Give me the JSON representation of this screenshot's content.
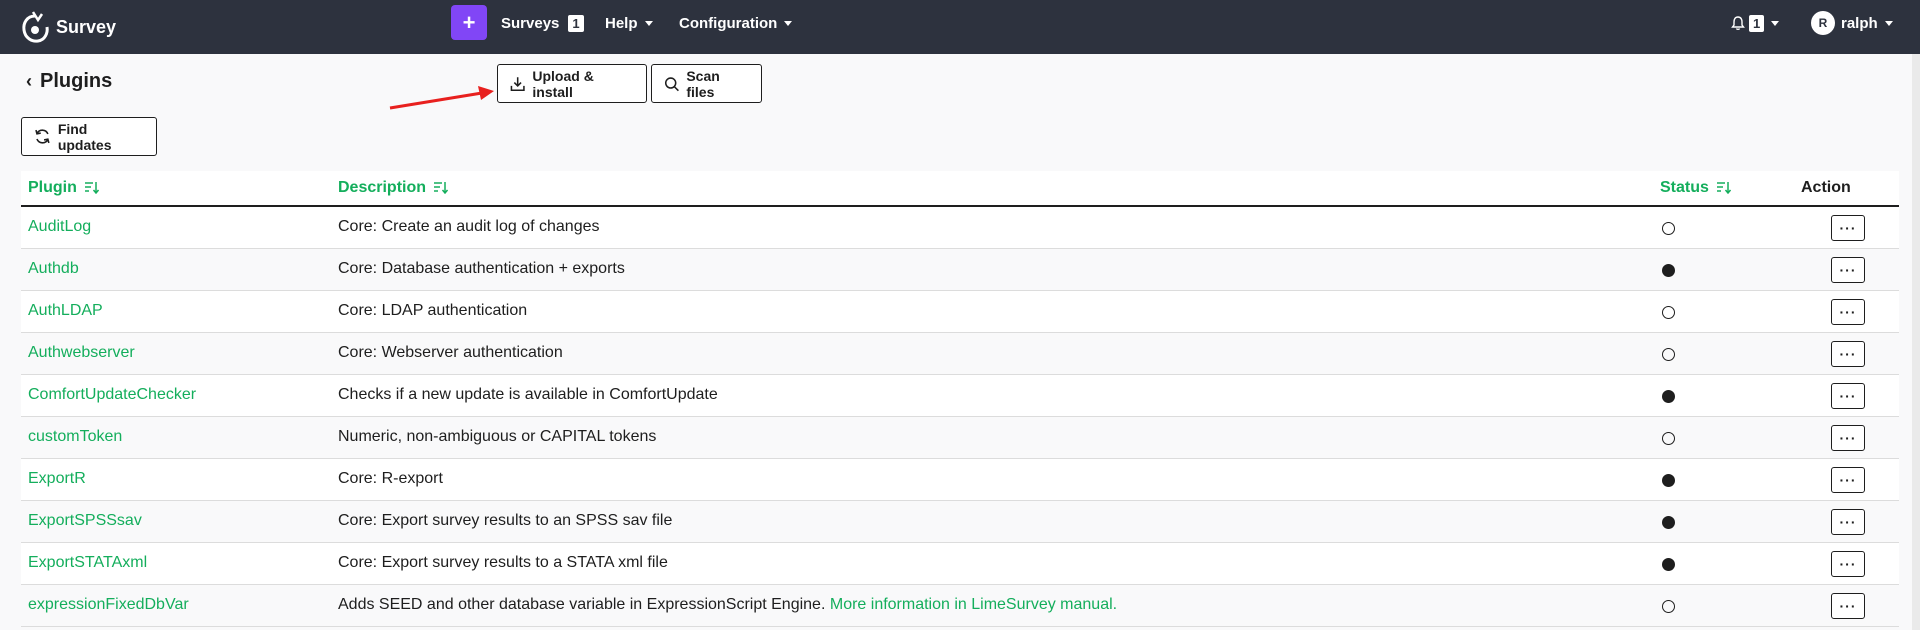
{
  "navbar": {
    "brand": "Survey",
    "plus_label": "+",
    "surveys_label": "Surveys",
    "surveys_count": "1",
    "help_label": "Help",
    "configuration_label": "Configuration",
    "notifications_count": "1",
    "user_initial": "R",
    "user_name": "ralph"
  },
  "page": {
    "back_chevron": "‹",
    "title": "Plugins"
  },
  "toolbar": {
    "upload_label": "Upload & install",
    "scan_label": "Scan files",
    "find_updates_label": "Find updates"
  },
  "table": {
    "headers": {
      "plugin": "Plugin",
      "description": "Description",
      "status": "Status",
      "action": "Action"
    },
    "rows": [
      {
        "name": "AuditLog",
        "description": "Core: Create an audit log of changes",
        "active": false
      },
      {
        "name": "Authdb",
        "description": "Core: Database authentication + exports",
        "active": true
      },
      {
        "name": "AuthLDAP",
        "description": "Core: LDAP authentication",
        "active": false
      },
      {
        "name": "Authwebserver",
        "description": "Core: Webserver authentication",
        "active": false
      },
      {
        "name": "ComfortUpdateChecker",
        "description": "Checks if a new update is available in ComfortUpdate",
        "active": true
      },
      {
        "name": "customToken",
        "description": "Numeric, non-ambiguous or CAPITAL tokens",
        "active": false
      },
      {
        "name": "ExportR",
        "description": "Core: R-export",
        "active": true
      },
      {
        "name": "ExportSPSSsav",
        "description": "Core: Export survey results to an SPSS sav file",
        "active": true
      },
      {
        "name": "ExportSTATAxml",
        "description": "Core: Export survey results to a STATA xml file",
        "active": true
      },
      {
        "name": "expressionFixedDbVar",
        "description": "Adds SEED and other database variable in ExpressionScript Engine.",
        "more_link": "More information in LimeSurvey manual.",
        "active": false
      }
    ],
    "action_label": "···"
  },
  "colors": {
    "navbar": "#2d323e",
    "accent": "#8146f6",
    "link": "#14ae5c",
    "annotation_arrow": "#e8201e"
  }
}
